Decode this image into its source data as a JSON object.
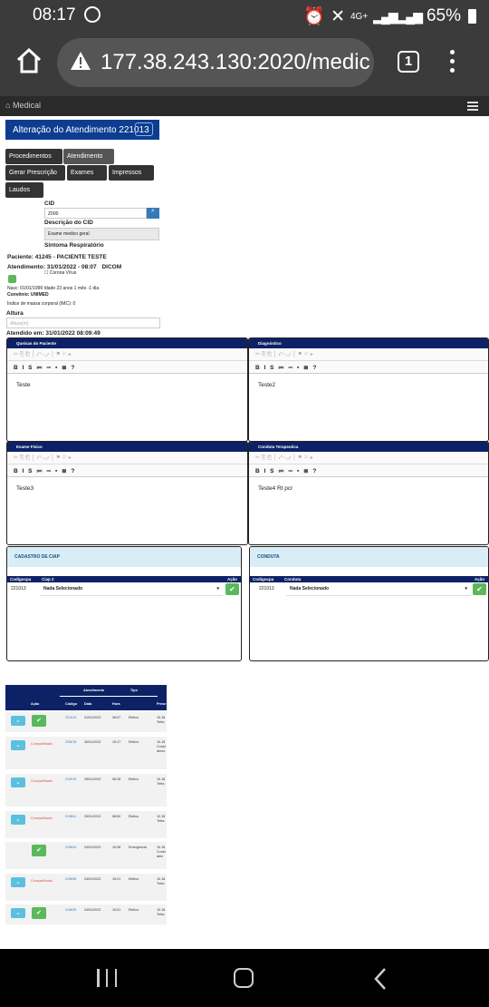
{
  "status_bar": {
    "time": "08:17",
    "network": "4G+",
    "battery": "65%"
  },
  "browser": {
    "url": "177.38.243.130:2020/medic",
    "tab_count": "1"
  },
  "app_header": {
    "brand": "Medical"
  },
  "form": {
    "title": "Alteração do Atendimento 221013",
    "tabs": [
      "Procedimentos",
      "Atendimento"
    ],
    "buttons": [
      "Gerar Prescrição",
      "Exames",
      "Impressos",
      "Laudos"
    ],
    "cid_label": "CID",
    "cid_value": "Z000",
    "descricao_label": "Descrição do CID",
    "descricao_value": "Exame medico geral",
    "sintoma_label": "Sintoma Respiratório",
    "sintoma_option": "Corona Vírus",
    "paciente_label": "Paciente:",
    "paciente_value": "41245 - PACIENTE TESTE",
    "atendimento_label": "Atendimento:",
    "atendimento_value": "31/01/2022 - 08:07",
    "dicom": "DICOM",
    "nasc": "Nasc: 01/01/1999 Idade 23 anos 1 mês -1 dia",
    "convenio": "Convênio: UNIMED",
    "imc": "Índice de massa corporal (IMC): 0",
    "altura_label": "Altura",
    "altura_placeholder": "Altura(m)",
    "atendido_em": "Atendido em: 31/01/2022 08:09:49"
  },
  "editors": [
    {
      "title": "Queixas do Paciente",
      "text": "Teste"
    },
    {
      "title": "Diagnóstico",
      "text": "Teste2"
    },
    {
      "title": "Exame Físico",
      "text": "Teste3"
    },
    {
      "title": "Conduta Terapeutica",
      "text": "Teste4 Rt pcr"
    }
  ],
  "toolbar": {
    "format_buttons": "B I S ≔ ═ ▪ ≣ ?"
  },
  "ciap": {
    "section": "CADASTRO DE CIAP",
    "col1": "Codigocpa",
    "col2": "Ciap 2",
    "col3": "Ação",
    "code": "221013",
    "select": "Nada Selecionado"
  },
  "conduta": {
    "section": "CONDUTA",
    "col1": "Codigocpa",
    "col2": "Conduta",
    "col3": "Ação",
    "code": "221013",
    "select": "Nada Selecionado"
  },
  "table": {
    "group_header": "Atendimento",
    "tipo_header": "Tipo",
    "headers": [
      "Ação",
      "Código",
      "Data",
      "Hora",
      "Prese"
    ],
    "rows": [
      {
        "status": "",
        "code": "221013",
        "date": "31/01/2022",
        "time": "08:07",
        "tipo": "Eletivo",
        "desc": "10.18 Telec",
        "has_blue": true,
        "has_green": true
      },
      {
        "status": "Compartilhado",
        "code": "220678",
        "date": "30/01/2022",
        "time": "19:17",
        "tipo": "Eletivo",
        "desc": "10.18 Const demo",
        "has_blue": true,
        "has_green": false
      },
      {
        "status": "Compartilhado",
        "code": "219919",
        "date": "25/01/2022",
        "time": "08:28",
        "tipo": "Eletivo",
        "desc": "10.18 Telec",
        "has_blue": true,
        "has_green": false
      },
      {
        "status": "Compartilhado",
        "code": "219841",
        "date": "25/01/2022",
        "time": "08:50",
        "tipo": "Eletivo",
        "desc": "10.18 Telec",
        "has_blue": true,
        "has_green": false
      },
      {
        "status": "",
        "code": "219644",
        "date": "24/01/2022",
        "time": "10:28",
        "tipo": "Emergencia",
        "desc": "10.18 Const aten",
        "has_blue": false,
        "has_green": true
      },
      {
        "status": "Compartilhado",
        "code": "219698",
        "date": "24/01/2022",
        "time": "19:21",
        "tipo": "Eletivo",
        "desc": "10.18 Telec",
        "has_blue": true,
        "has_green": false
      },
      {
        "status": "",
        "code": "219625",
        "date": "24/01/2022",
        "time": "10:01",
        "tipo": "Eletivo",
        "desc": "10.18 Telec",
        "has_blue": true,
        "has_green": true
      }
    ]
  }
}
